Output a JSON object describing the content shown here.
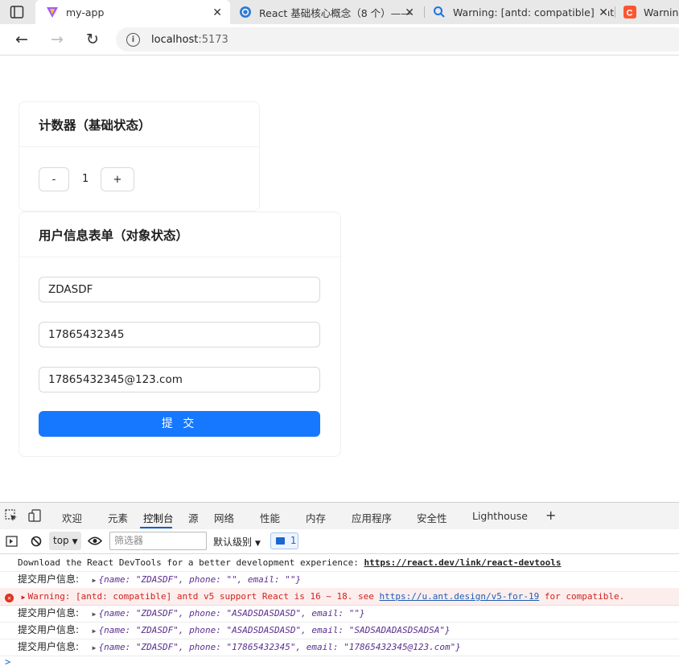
{
  "browser": {
    "tabs": [
      {
        "title": "my-app",
        "active": true
      },
      {
        "title": "React 基础核心概念（8 个）——",
        "active": false
      },
      {
        "title": "Warning: [antd: compatible] antd",
        "active": false
      },
      {
        "title": "Warning",
        "active": false
      }
    ],
    "url": {
      "host": "localhost",
      "port": ":5173"
    }
  },
  "counter_card": {
    "title": "计数器（基础状态）",
    "minus": "-",
    "count": "1",
    "plus": "+"
  },
  "form_card": {
    "title": "用户信息表单（对象状态）",
    "name_value": "ZDASDF",
    "phone_value": "17865432345",
    "email_value": "17865432345@123.com",
    "submit": "提 交"
  },
  "devtools": {
    "tabs": [
      "欢迎",
      "元素",
      "控制台",
      "源",
      "网络",
      "性能",
      "内存",
      "应用程序",
      "安全性",
      "Lighthouse",
      "+"
    ],
    "active_tab": "控制台",
    "toolbar": {
      "context": "top",
      "filter_placeholder": "筛选器",
      "level": "默认级别",
      "issues_count": "1"
    },
    "console": {
      "line1_text": "Download the React DevTools for a better development experience: ",
      "line1_link": "https://react.dev/link/react-devtools",
      "log_label": "提交用户信息:",
      "log1": "{name: \"ZDASDF\", phone: \"\", email: \"\"}",
      "warn_text": "Warning: [antd: compatible] antd v5 support React is 16 ~ 18. see ",
      "warn_link": "https://u.ant.design/v5-for-19",
      "warn_tail": " for compatible.",
      "log2": "{name: \"ZDASDF\", phone: \"ASADSDASDASD\", email: \"\"}",
      "log3": "{name: \"ZDASDF\", phone: \"ASADSDASDASD\", email: \"SADSADADASDSADSA\"}",
      "log4": "{name: \"ZDASDF\", phone: \"17865432345\", email: \"17865432345@123.com\"}",
      "prompt": ">"
    }
  },
  "colors": {
    "primary": "#1677ff",
    "error_bg": "#fdeeee",
    "error_text": "#d0221b"
  }
}
